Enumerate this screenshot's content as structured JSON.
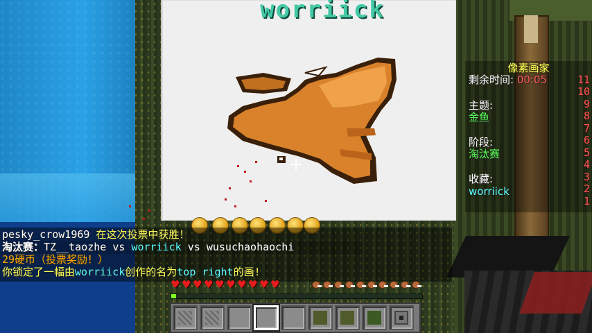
{
  "world": {
    "sign_text": "worriick",
    "colors": {
      "canvas": "#efefef",
      "fish_body": "#d9822b",
      "fish_outline": "#3a200a",
      "blood": "#c01818"
    }
  },
  "sidebar": {
    "title": "像素画家",
    "time_label": "剩余时间: ",
    "time_value": "00:05",
    "theme_label": "主题:",
    "theme_value": "金鱼",
    "stage_label": "阶段:",
    "stage_value": "淘汰赛",
    "favorite_label": "收藏:",
    "favorite_value": "worriick",
    "scores": [
      "11",
      "10",
      "9",
      "8",
      "7",
      "6",
      "5",
      "4",
      "3",
      "2",
      "1"
    ]
  },
  "chat": {
    "line1": {
      "player": "pesky_crow1969",
      "text": " 在这次投票中获胜！"
    },
    "line2": {
      "prefix": "淘汰赛：",
      "p1": "TZ__taozhe",
      "vs1": " vs ",
      "p2": "worriick",
      "vs2": " vs ",
      "p3": "wusuchaohaochi"
    },
    "line3": {
      "text": "29硬币（投票奖励！）"
    },
    "line4": {
      "pre": "你锁定了一幅由",
      "player": "worriick",
      "mid": "创作的名为",
      "title": "top right",
      "post": "的画!"
    }
  },
  "hud": {
    "hearts": 10,
    "food": 10,
    "xp_progress": 0.02,
    "hotbar": {
      "selected_slot": 2,
      "slots": [
        "gravel-block",
        "gravel-block",
        "empty",
        "empty",
        "empty",
        "sponge-block",
        "sponge-block",
        "empty",
        "dispenser-block"
      ]
    }
  }
}
